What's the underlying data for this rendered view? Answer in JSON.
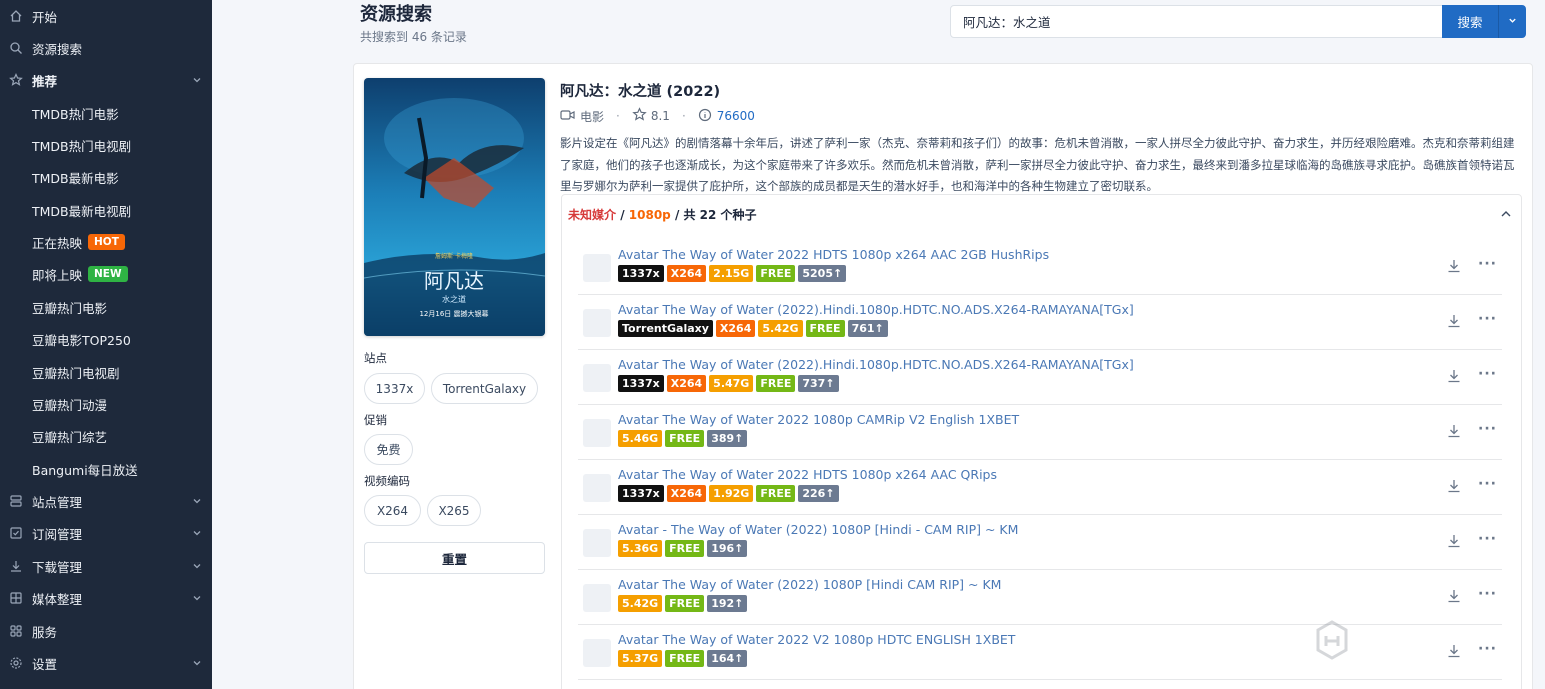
{
  "sidebar": {
    "items": [
      {
        "label": "开始",
        "icon": "home-icon"
      },
      {
        "label": "资源搜索",
        "icon": "search-icon"
      },
      {
        "label": "推荐",
        "icon": "star-icon"
      },
      {
        "label": "TMDB热门电影"
      },
      {
        "label": "TMDB热门电视剧"
      },
      {
        "label": "TMDB最新电影"
      },
      {
        "label": "TMDB最新电视剧"
      },
      {
        "label": "正在热映",
        "badge": "HOT"
      },
      {
        "label": "即将上映",
        "badge": "NEW"
      },
      {
        "label": "豆瓣热门电影"
      },
      {
        "label": "豆瓣电影TOP250"
      },
      {
        "label": "豆瓣热门电视剧"
      },
      {
        "label": "豆瓣热门动漫"
      },
      {
        "label": "豆瓣热门综艺"
      },
      {
        "label": "Bangumi每日放送"
      },
      {
        "label": "站点管理",
        "icon": "server-icon"
      },
      {
        "label": "订阅管理",
        "icon": "checklist-icon"
      },
      {
        "label": "下载管理",
        "icon": "download-icon"
      },
      {
        "label": "媒体整理",
        "icon": "grid-icon"
      },
      {
        "label": "服务",
        "icon": "apps-icon"
      },
      {
        "label": "设置",
        "icon": "gear-icon"
      }
    ]
  },
  "header": {
    "title": "资源搜索",
    "subtitle": "共搜索到 46 条记录"
  },
  "search": {
    "value": "阿凡达：水之道",
    "button_label": "搜索"
  },
  "movie": {
    "title": "阿凡达：水之道 (2022)",
    "type": "电影",
    "rating": "8.1",
    "votes": "76600",
    "overview": "影片设定在《阿凡达》的剧情落幕十余年后，讲述了萨利一家（杰克、奈蒂莉和孩子们）的故事：危机未曾消散，一家人拼尽全力彼此守护、奋力求生，并历经艰险磨难。杰克和奈蒂莉组建了家庭，他们的孩子也逐渐成长，为这个家庭带来了许多欢乐。然而危机未曾消散，萨利一家拼尽全力彼此守护、奋力求生，最终来到潘多拉星球临海的岛礁族寻求庇护。岛礁族首领特诺瓦里与罗娜尔为萨利一家提供了庇护所，这个部族的成员都是天生的潜水好手，也和海洋中的各种生物建立了密切联系。",
    "poster_text": {
      "top": "詹姆斯·卡梅隆",
      "cn_title": "阿凡达",
      "cn_sub": "水之道",
      "date": "12月16日 震撼大银幕"
    }
  },
  "filters": {
    "site_label": "站点",
    "sites": [
      "1337x",
      "TorrentGalaxy"
    ],
    "promo_label": "促销",
    "promos": [
      "免费"
    ],
    "codec_label": "视频编码",
    "codecs": [
      "X264",
      "X265"
    ],
    "reset_label": "重置"
  },
  "torrents": {
    "group_unknown": "未知媒介",
    "group_sep": " / ",
    "group_res": "1080p",
    "group_count": " / 共 22 个种子",
    "rows": [
      {
        "title": "Avatar The Way of Water 2022 HDTS 1080p x264 AAC 2GB HushRips",
        "site": "1337x",
        "codec": "X264",
        "size": "2.15G",
        "free": "FREE",
        "seeds": "5205↑"
      },
      {
        "title": "Avatar The Way of Water (2022).Hindi.1080p.HDTC.NO.ADS.X264-RAMAYANA[TGx]",
        "site": "TorrentGalaxy",
        "codec": "X264",
        "size": "5.42G",
        "free": "FREE",
        "seeds": "761↑"
      },
      {
        "title": "Avatar The Way of Water (2022).Hindi.1080p.HDTC.NO.ADS.X264-RAMAYANA[TGx]",
        "site": "1337x",
        "codec": "X264",
        "size": "5.47G",
        "free": "FREE",
        "seeds": "737↑"
      },
      {
        "title": "Avatar The Way of Water 2022 1080p CAMRip V2 English 1XBET",
        "site": "",
        "codec": "",
        "size": "5.46G",
        "free": "FREE",
        "seeds": "389↑"
      },
      {
        "title": "Avatar The Way of Water 2022 HDTS 1080p x264 AAC QRips",
        "site": "1337x",
        "codec": "X264",
        "size": "1.92G",
        "free": "FREE",
        "seeds": "226↑"
      },
      {
        "title": "Avatar - The Way of Water (2022) 1080P [Hindi - CAM RIP] ~ KM",
        "site": "",
        "codec": "",
        "size": "5.36G",
        "free": "FREE",
        "seeds": "196↑"
      },
      {
        "title": "Avatar The Way of Water (2022) 1080P [Hindi CAM RIP] ~ KM",
        "site": "",
        "codec": "",
        "size": "5.42G",
        "free": "FREE",
        "seeds": "192↑"
      },
      {
        "title": "Avatar The Way of Water 2022 V2 1080p HDTC ENGLISH 1XBET",
        "site": "",
        "codec": "",
        "size": "5.37G",
        "free": "FREE",
        "seeds": "164↑"
      }
    ]
  },
  "watermark": "小黑盒"
}
